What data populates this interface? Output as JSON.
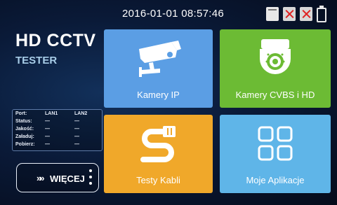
{
  "status_bar": {
    "datetime": "2016-01-01 08:57:46",
    "icons": [
      "sd-card-icon",
      "no-signal-icon",
      "no-network-icon",
      "battery-icon"
    ]
  },
  "brand": {
    "title": "HD CCTV",
    "subtitle": "TESTER"
  },
  "port_status": {
    "headers": [
      "Port:",
      "LAN1",
      "LAN2"
    ],
    "rows": [
      {
        "label": "Status:",
        "lan1": "—",
        "lan2": "—"
      },
      {
        "label": "Jakość:",
        "lan1": "—",
        "lan2": "—"
      },
      {
        "label": "Załaduj:",
        "lan1": "—",
        "lan2": "—"
      },
      {
        "label": "Pobierz:",
        "lan1": "—",
        "lan2": "—"
      }
    ]
  },
  "more_button": {
    "chevrons": "»»",
    "label": "WIĘCEJ"
  },
  "tiles": [
    {
      "label": "Kamery IP",
      "icon": "camera-icon",
      "color": "#5b9ee4"
    },
    {
      "label": "Kamery CVBS i HD",
      "icon": "dome-camera-icon",
      "color": "#6cbb34"
    },
    {
      "label": "Testy Kabli",
      "icon": "cable-icon",
      "color": "#f0a82a"
    },
    {
      "label": "Moje Aplikacje",
      "icon": "apps-grid-icon",
      "color": "#5fb5e8"
    }
  ]
}
